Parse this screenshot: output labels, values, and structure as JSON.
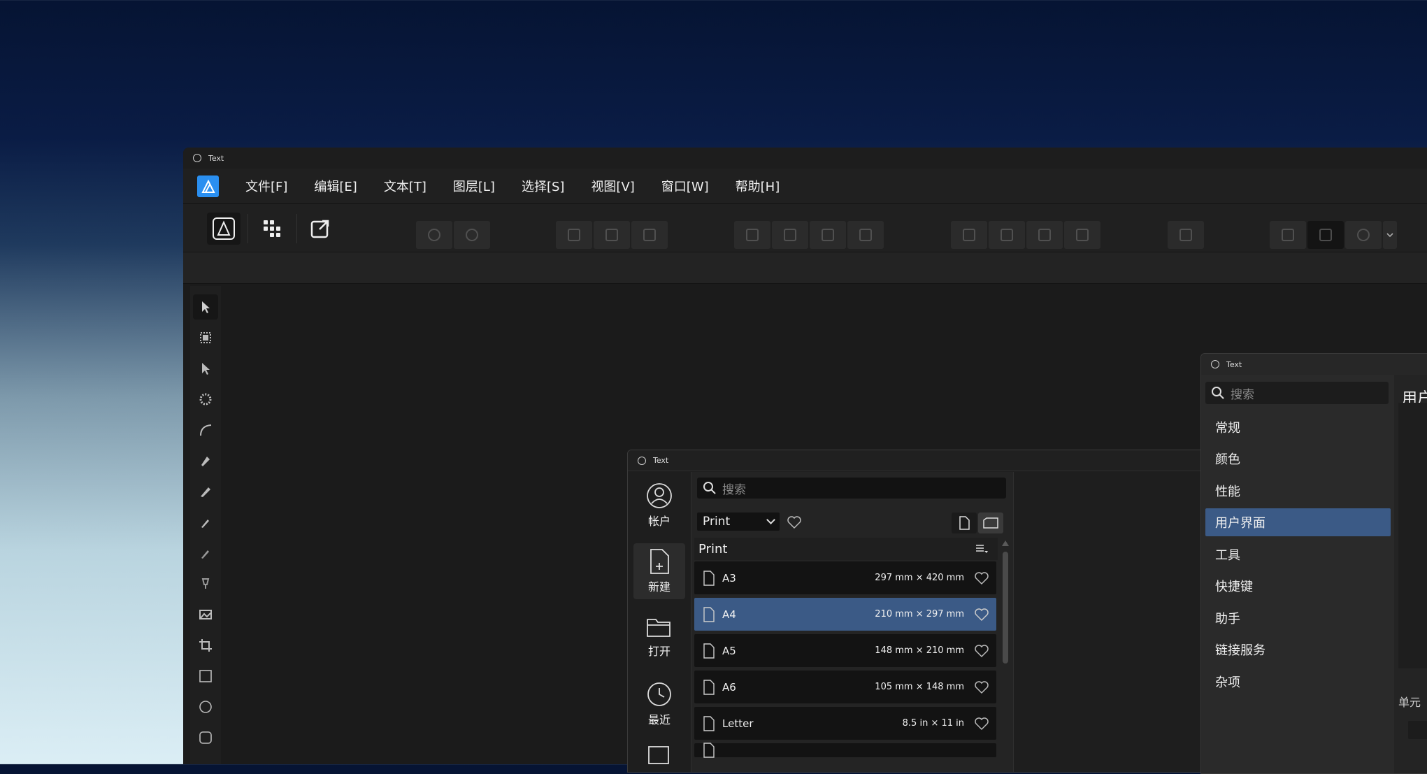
{
  "main_window": {
    "title": "Text",
    "menu": [
      "文件[F]",
      "编辑[E]",
      "文本[T]",
      "图层[L]",
      "选择[S]",
      "视图[V]",
      "窗口[W]",
      "帮助[H]"
    ]
  },
  "new_document": {
    "title": "Text",
    "sidebar": [
      "帐户",
      "新建",
      "打开",
      "最近"
    ],
    "search_placeholder": "搜索",
    "category": "Print",
    "list_header": "Print",
    "presets": [
      {
        "name": "A3",
        "size": "297 mm × 420 mm"
      },
      {
        "name": "A4",
        "size": "210 mm × 297 mm"
      },
      {
        "name": "A5",
        "size": "148 mm × 210 mm"
      },
      {
        "name": "A6",
        "size": "105 mm × 148 mm"
      },
      {
        "name": "Letter",
        "size": "8.5 in × 11 in"
      }
    ],
    "selected_preset": "A4"
  },
  "preferences": {
    "title": "Text",
    "search_placeholder": "搜索",
    "sections": [
      "常规",
      "颜色",
      "性能",
      "用户界面",
      "工具",
      "快捷键",
      "助手",
      "链接服务",
      "杂项"
    ],
    "selected_section": "用户界面",
    "content_heading_partial": "用户",
    "content_label_partial": "单元"
  },
  "colors": {
    "accent": "#3b5a86",
    "app_icon": "#2a8ff0"
  }
}
